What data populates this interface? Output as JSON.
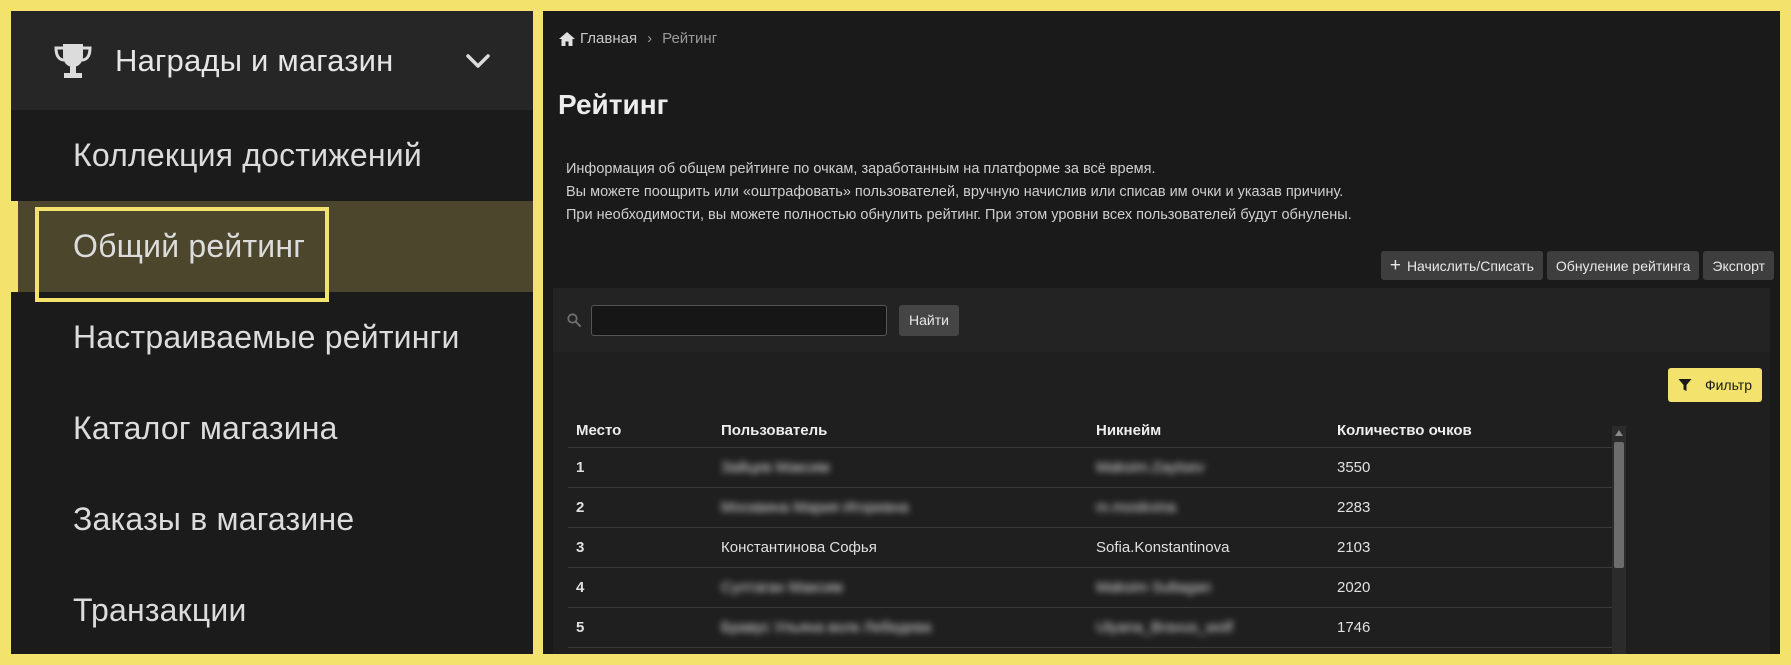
{
  "sidebar": {
    "section_title": "Награды и магазин",
    "section_icon": "trophy-icon",
    "items": [
      {
        "label": "Коллекция достижений",
        "active": false
      },
      {
        "label": "Общий рейтинг",
        "active": true
      },
      {
        "label": "Настраиваемые рейтинги",
        "active": false
      },
      {
        "label": "Каталог магазина",
        "active": false
      },
      {
        "label": "Заказы в магазине",
        "active": false
      },
      {
        "label": "Транзакции",
        "active": false
      }
    ]
  },
  "breadcrumb": {
    "home": "Главная",
    "current": "Рейтинг"
  },
  "page": {
    "title": "Рейтинг",
    "info": [
      "Информация об общем рейтинге по очкам, заработанным на платформе за всё время.",
      "Вы можете поощрить или «оштрафовать» пользователей, вручную начислив или списав им очки и указав причину.",
      "При необходимости, вы можете полностью обнулить рейтинг. При этом уровни всех пользователей будут обнулены."
    ]
  },
  "actions": {
    "accrue": "Начислить/Списать",
    "reset": "Обнуление рейтинга",
    "export": "Экспорт"
  },
  "search": {
    "value": "",
    "placeholder": "",
    "button": "Найти"
  },
  "filter_label": "Фильтр",
  "table": {
    "columns": [
      "Место",
      "Пользователь",
      "Никнейм",
      "Количество очков"
    ],
    "rows": [
      {
        "place": "1",
        "user": "Зайцев Максим",
        "nickname": "Maksim.Zaytsev",
        "points": "3550",
        "blurred": true
      },
      {
        "place": "2",
        "user": "Москвина Мария Игоревна",
        "nickname": "m.moskvina",
        "points": "2283",
        "blurred": true
      },
      {
        "place": "3",
        "user": "Константинова Софья",
        "nickname": "Sofia.Konstantinova",
        "points": "2103",
        "blurred": false
      },
      {
        "place": "4",
        "user": "Султаган Максим",
        "nickname": "Maksim Sultagan",
        "points": "2020",
        "blurred": true
      },
      {
        "place": "5",
        "user": "Бравус Ульяна волк Лебедева",
        "nickname": "Ulyana_Bravus_wolf",
        "points": "1746",
        "blurred": true
      }
    ]
  },
  "colors": {
    "accent": "#f3e26b",
    "active_bg": "#4c462c",
    "panel_bg": "#1a1a1a"
  }
}
